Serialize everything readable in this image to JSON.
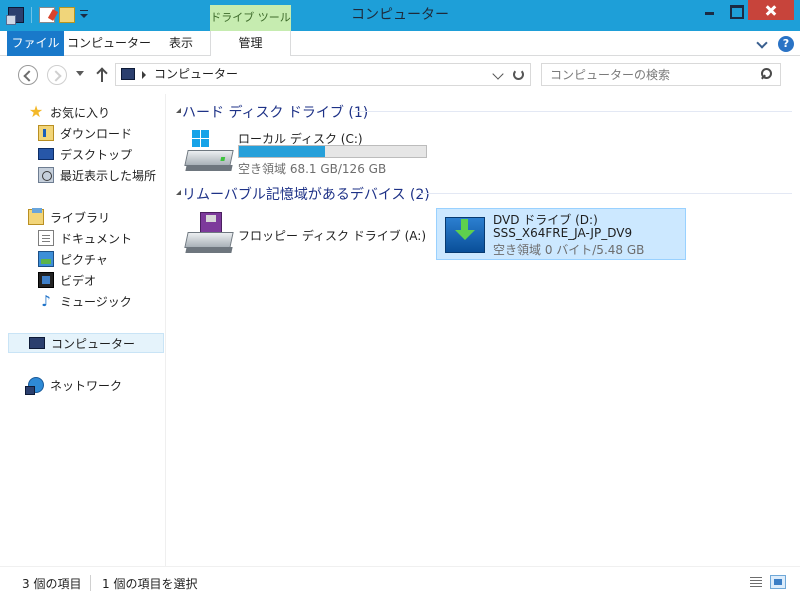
{
  "window": {
    "title": "コンピューター",
    "context_tab_group": "ドライブ ツール"
  },
  "ribbon": {
    "tabs": [
      {
        "label": "ファイル"
      },
      {
        "label": "コンピューター"
      },
      {
        "label": "表示"
      },
      {
        "label": "管理"
      }
    ],
    "help_label": "?"
  },
  "address": {
    "crumb": "コンピューター"
  },
  "search": {
    "placeholder": "コンピューターの検索"
  },
  "navpane": {
    "favorites": {
      "label": "お気に入り",
      "items": [
        {
          "label": "ダウンロード"
        },
        {
          "label": "デスクトップ"
        },
        {
          "label": "最近表示した場所"
        }
      ]
    },
    "libraries": {
      "label": "ライブラリ",
      "items": [
        {
          "label": "ドキュメント"
        },
        {
          "label": "ピクチャ"
        },
        {
          "label": "ビデオ"
        },
        {
          "label": "ミュージック"
        }
      ]
    },
    "computer": {
      "label": "コンピューター"
    },
    "network": {
      "label": "ネットワーク"
    }
  },
  "content": {
    "groups": [
      {
        "header": "ハード ディスク ドライブ (1)",
        "items": [
          {
            "name": "ローカル ディスク (C:)",
            "free_text": "空き領域 68.1 GB/126 GB",
            "used_fraction": 0.46,
            "icon": "hard-drive-icon"
          }
        ]
      },
      {
        "header": "リムーバブル記憶域があるデバイス (2)",
        "items": [
          {
            "name": "フロッピー ディスク ドライブ (A:)",
            "icon": "floppy-drive-icon"
          },
          {
            "name": "DVD ドライブ (D:)",
            "volume_label": "SSS_X64FRE_JA-JP_DV9",
            "free_text": "空き領域 0 バイト/5.48 GB",
            "icon": "dvd-drive-icon",
            "selected": true
          }
        ]
      }
    ]
  },
  "status": {
    "item_count": "3 個の項目",
    "selected": "1 個の項目を選択"
  },
  "colors": {
    "titlebar": "#1e9fd8",
    "file_tab": "#1979ca",
    "context_tab": "#c6ecb0",
    "close_button": "#c7443b",
    "group_header": "#1e3287",
    "capacity_fill": "#26a0da",
    "selection": "#cce8ff"
  }
}
